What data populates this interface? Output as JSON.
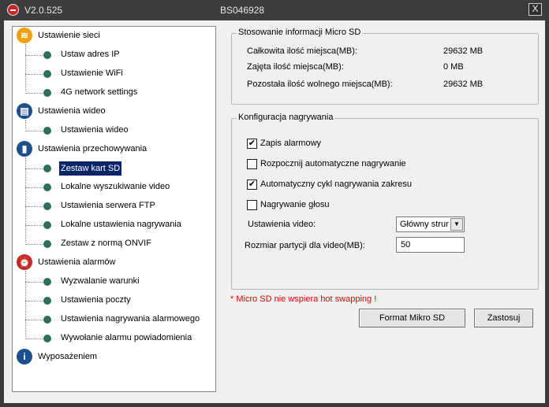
{
  "window": {
    "version": "V2.0.525",
    "serial": "BS046928",
    "close": "X"
  },
  "tree": {
    "categories": [
      {
        "label": "Ustawienie sieci",
        "icon": "wifi-icon",
        "color": "#f2a007",
        "items": [
          "Ustaw adres IP",
          "Ustawienie WiFi",
          "4G network settings"
        ]
      },
      {
        "label": "Ustawienia wideo",
        "icon": "film-icon",
        "color": "#1d4f8c",
        "items": [
          "Ustawienia wideo"
        ]
      },
      {
        "label": "Ustawienia przechowywania",
        "icon": "storage-icon",
        "color": "#1d4f8c",
        "items": [
          "Zestaw kart SD",
          "Lokalne wyszukiwanie video",
          "Ustawienia serwera FTP",
          "Lokalne ustawienia nagrywania",
          "Zestaw z normą ONVIF"
        ]
      },
      {
        "label": "Ustawienia alarmów",
        "icon": "alarm-clock-icon",
        "color": "#c62828",
        "items": [
          "Wyzwalanie warunki",
          "Ustawienia poczty",
          "Ustawienia nagrywania alarmowego",
          "Wywołanie alarmu powiadomienia"
        ]
      },
      {
        "label": "Wyposażeniem",
        "icon": "info-icon",
        "color": "#1d4f8c",
        "items": []
      }
    ],
    "selected": "Zestaw kart SD"
  },
  "sd_info": {
    "title": "Stosowanie informacji Micro SD",
    "rows": [
      {
        "label": "Całkowita ilość miejsca(MB):",
        "value": "29632 MB"
      },
      {
        "label": "Zajęta ilość miejsca(MB):",
        "value": "0 MB"
      },
      {
        "label": "Pozostała ilość wolnego miejsca(MB):",
        "value": "29632 MB"
      }
    ]
  },
  "recording": {
    "title": "Konfiguracja nagrywania",
    "options": [
      {
        "label": "Zapis alarmowy",
        "checked": true
      },
      {
        "label": "Rozpocznij automatyczne nagrywanie",
        "checked": false
      },
      {
        "label": "Automatyczny cykl nagrywania zakresu",
        "checked": true
      },
      {
        "label": "Nagrywanie głosu",
        "checked": false
      }
    ],
    "video_label": "Ustawienia video:",
    "video_value": "Główny strumień",
    "partition_label": "Rozmiar partycji dla video(MB):",
    "partition_value": "50"
  },
  "warning": "* Micro SD nie wspiera hot swapping !",
  "buttons": {
    "format": "Format Mikro SD",
    "apply": "Zastosuj"
  },
  "colors": {
    "bullet": "#2f6f60",
    "selection": "#0a246a",
    "warning": "#e00000"
  }
}
